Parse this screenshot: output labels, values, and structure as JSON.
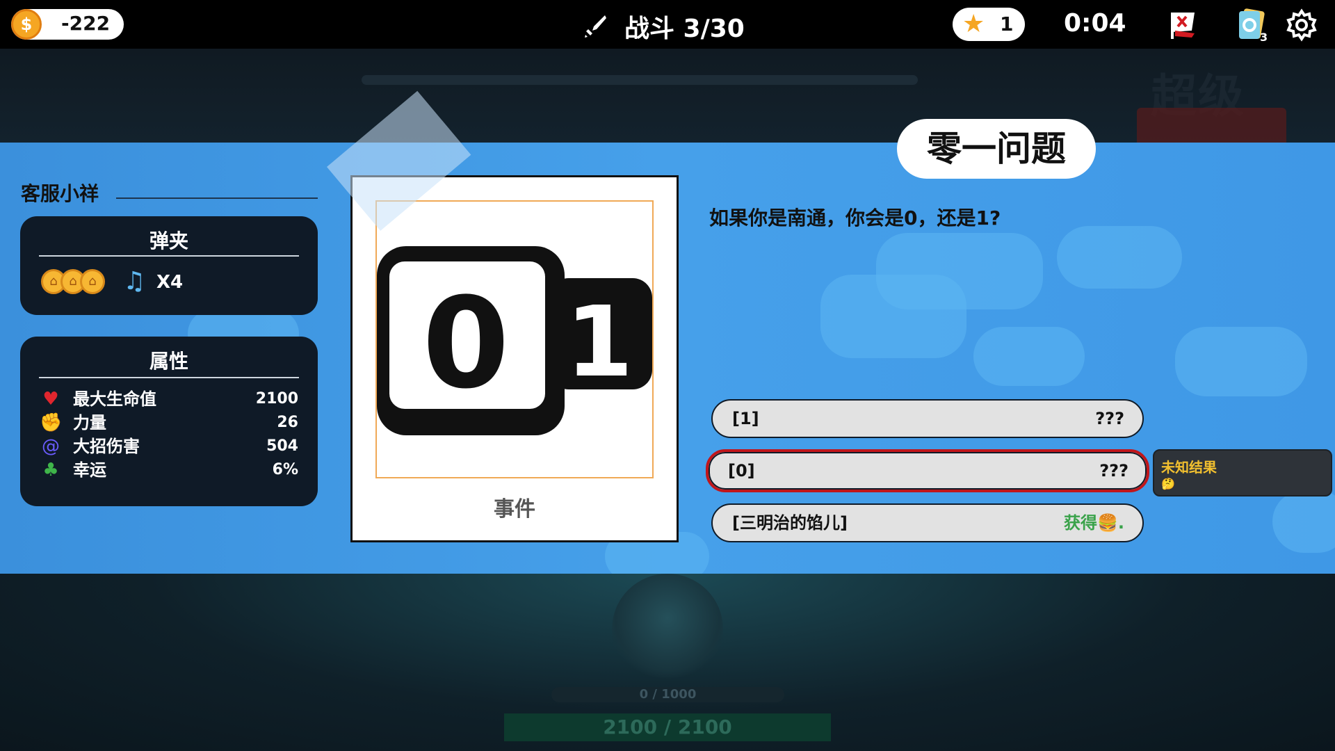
{
  "topbar": {
    "coins": "-222",
    "coin_symbol": "$",
    "battle": "战斗 3/30",
    "stars": "1",
    "timer": "0:04",
    "deck_count": "3"
  },
  "background": {
    "logo_text": "超级",
    "hp_bar_text": "0 / 1000",
    "hp_total": "2100 / 2100"
  },
  "character": {
    "name": "客服小祥",
    "magazine": {
      "title": "弹夹",
      "count": "X4"
    },
    "attributes": {
      "title": "属性",
      "items": [
        {
          "icon": "heart-icon",
          "label": "最大生命值",
          "value": "2100"
        },
        {
          "icon": "fist-icon",
          "label": "力量",
          "value": "26"
        },
        {
          "icon": "vortex-icon",
          "label": "大招伤害",
          "value": "504"
        },
        {
          "icon": "clover-icon",
          "label": "幸运",
          "value": "6%"
        }
      ]
    }
  },
  "card": {
    "label": "事件",
    "digit_left": "0",
    "digit_right": "1"
  },
  "event": {
    "title": "零一问题",
    "description": "如果你是南通，你会是0，还是1?",
    "options": [
      {
        "label": "[1]",
        "result": "???"
      },
      {
        "label": "[0]",
        "result": "???"
      },
      {
        "label": "[三明治的馅儿]",
        "result": "获得🍔."
      }
    ],
    "tooltip": {
      "title": "未知结果",
      "emoji": "🤔"
    }
  },
  "colors": {
    "band": "#46a0ea",
    "panel": "#0f1a27",
    "selected_border": "#c0161b",
    "tooltip_title": "#f2c02f",
    "gain_text": "#3aa24a"
  }
}
